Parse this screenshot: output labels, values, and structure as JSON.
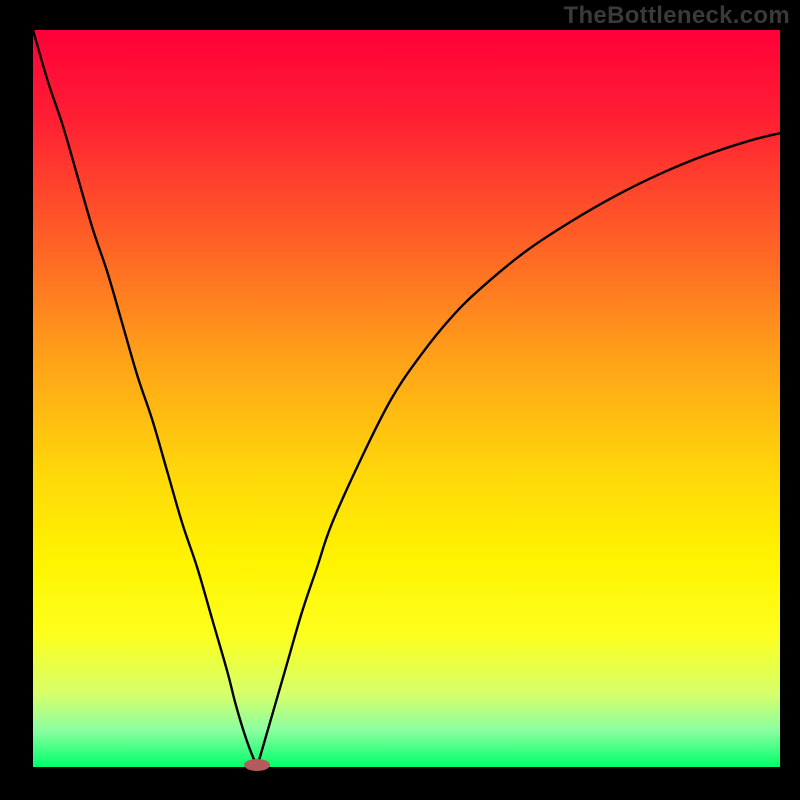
{
  "watermark": "TheBottleneck.com",
  "chart_data": {
    "type": "line",
    "title": "",
    "xlabel": "",
    "ylabel": "",
    "xlim": [
      0,
      100
    ],
    "ylim": [
      0,
      100
    ],
    "grid": false,
    "legend": false,
    "background": {
      "type": "vertical-gradient",
      "stops": [
        {
          "offset": 0.0,
          "color": "#ff0039"
        },
        {
          "offset": 0.12,
          "color": "#ff1f33"
        },
        {
          "offset": 0.28,
          "color": "#ff5e27"
        },
        {
          "offset": 0.45,
          "color": "#ffa318"
        },
        {
          "offset": 0.6,
          "color": "#ffd70a"
        },
        {
          "offset": 0.72,
          "color": "#fff400"
        },
        {
          "offset": 0.82,
          "color": "#fdff1e"
        },
        {
          "offset": 0.9,
          "color": "#d6ff6a"
        },
        {
          "offset": 0.95,
          "color": "#8bffa0"
        },
        {
          "offset": 1.0,
          "color": "#00ff6a"
        }
      ]
    },
    "series": [
      {
        "name": "left-branch",
        "color": "#000000",
        "x": [
          0,
          2,
          4,
          6,
          8,
          10,
          12,
          14,
          16,
          18,
          20,
          22,
          24,
          26,
          27,
          28,
          29,
          30
        ],
        "y": [
          100,
          93,
          87,
          80,
          73,
          67,
          60,
          53,
          47,
          40,
          33,
          27,
          20,
          13,
          9,
          5.5,
          2.5,
          0
        ]
      },
      {
        "name": "right-branch",
        "color": "#000000",
        "x": [
          30,
          31,
          32,
          34,
          36,
          38,
          40,
          44,
          48,
          52,
          56,
          60,
          66,
          72,
          78,
          84,
          90,
          96,
          100
        ],
        "y": [
          0,
          3.5,
          7,
          14,
          21,
          27,
          33,
          42,
          50,
          56,
          61,
          65,
          70,
          74,
          77.5,
          80.5,
          83,
          85,
          86
        ]
      }
    ],
    "marker": {
      "x": 30,
      "y": 0,
      "color": "#b55a5a",
      "rx": 2.5,
      "ry": 1.2
    }
  }
}
